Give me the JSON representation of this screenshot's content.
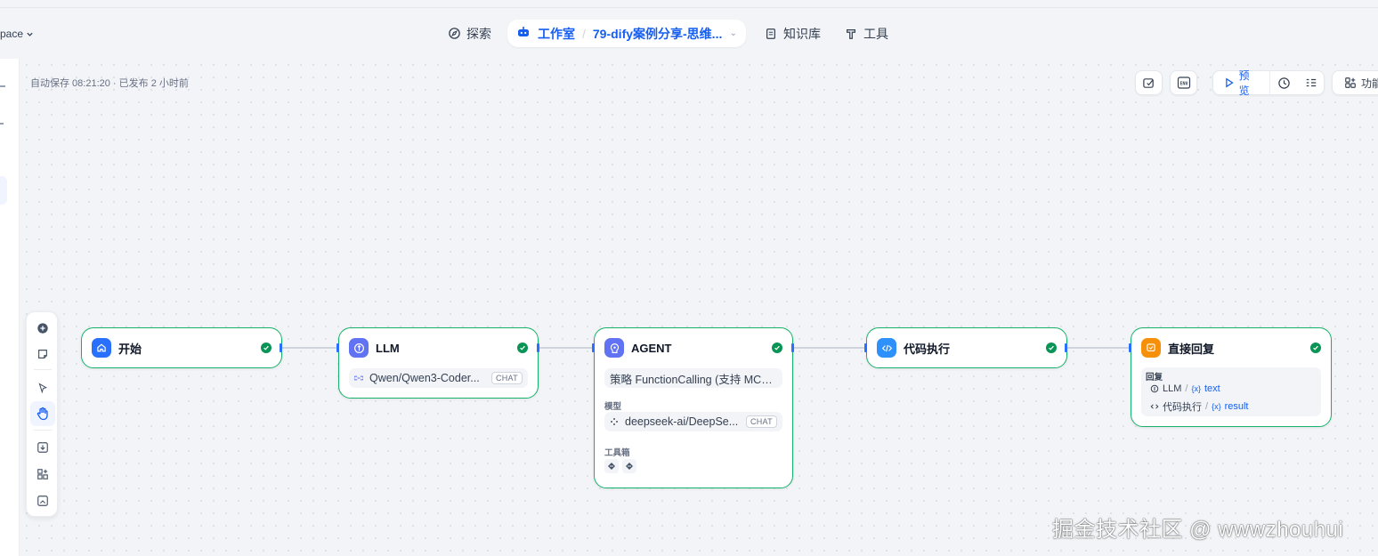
{
  "header": {
    "workspace_label": "pace",
    "nav": {
      "explore": "探索",
      "studio": "工作室",
      "app_name": "79-dify案例分享-思维...",
      "knowledge": "知识库",
      "tools": "工具"
    }
  },
  "canvas": {
    "autosave_text": "自动保存 08:21:20 · 已发布 2 小时前"
  },
  "toolbar": {
    "env_label": "ENV",
    "preview_label": "预览",
    "features_label": "功能"
  },
  "nodes": {
    "start": {
      "title": "开始"
    },
    "llm": {
      "title": "LLM",
      "model": "Qwen/Qwen3-Coder...",
      "model_badge": "CHAT"
    },
    "agent": {
      "title": "AGENT",
      "strategy": "策略 FunctionCalling (支持 MCP ...",
      "model_label": "模型",
      "model": "deepseek-ai/DeepSe...",
      "model_badge": "CHAT",
      "toolbox_label": "工具箱"
    },
    "code": {
      "title": "代码执行"
    },
    "answer": {
      "title": "直接回复",
      "reply_label": "回复",
      "refs": [
        {
          "node": "LLM",
          "var": "text"
        },
        {
          "node": "代码执行",
          "var": "result"
        }
      ]
    }
  },
  "colors": {
    "accent": "#155eef",
    "success": "#17b26a",
    "start_icon": "#2970ff",
    "llm_icon": "#6172f3",
    "agent_icon": "#6172f3",
    "code_icon": "#2e90fa",
    "answer_icon": "#f79009"
  },
  "watermark": "掘金技术社区 @ wwwzhouhui"
}
